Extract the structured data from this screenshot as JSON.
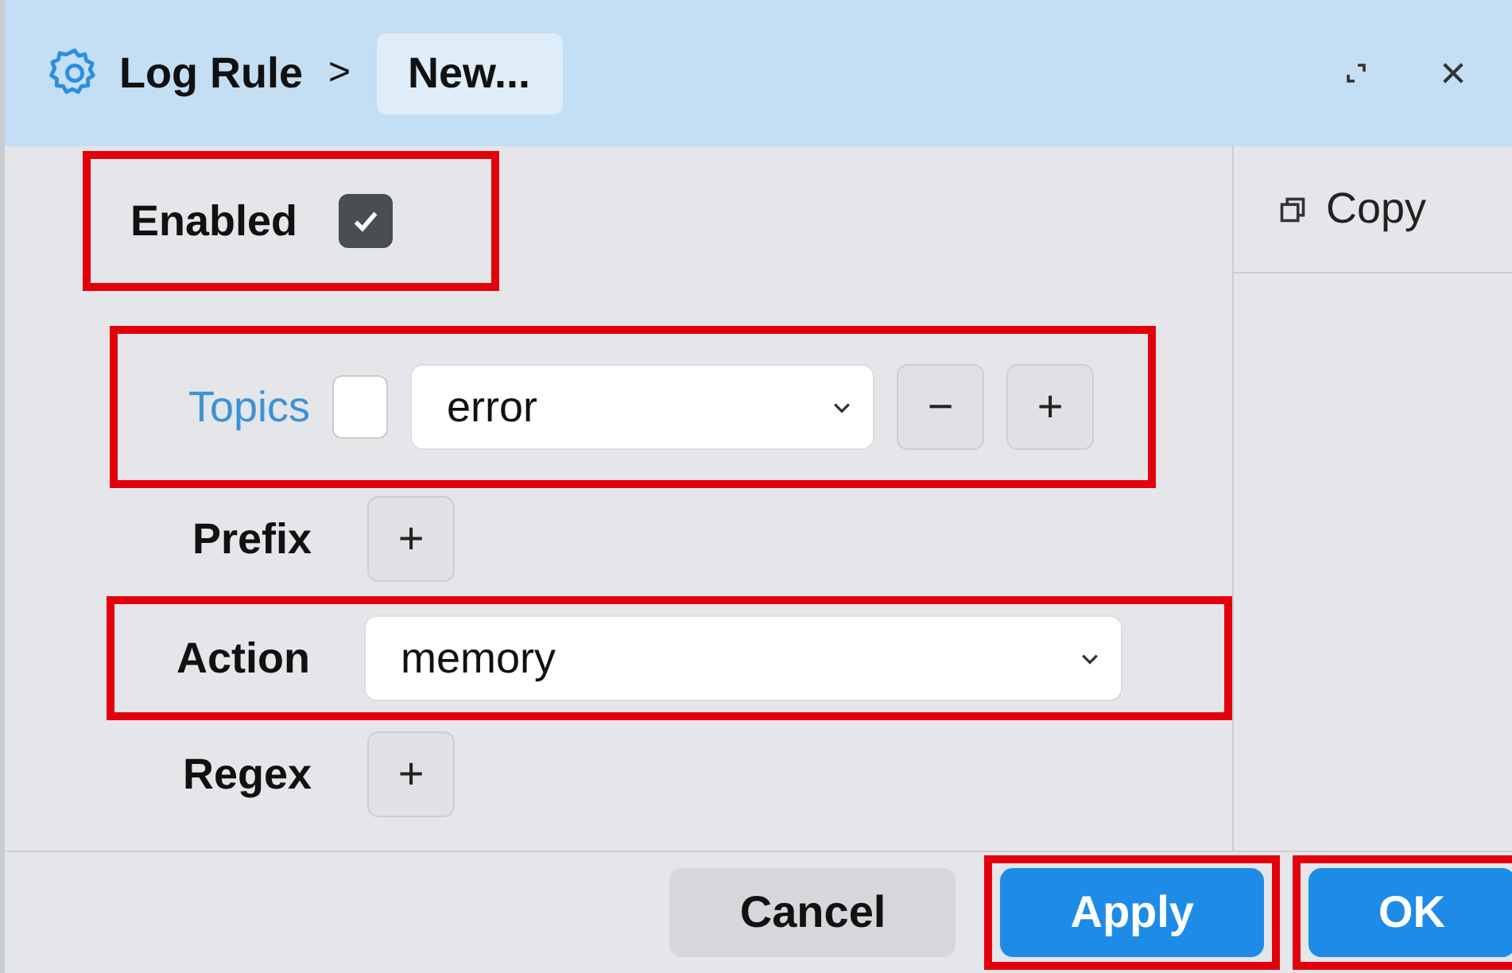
{
  "window": {
    "breadcrumb": "Log Rule",
    "separator": ">",
    "title": "New..."
  },
  "side_panel": {
    "copy_button": "Copy"
  },
  "enabled": {
    "label": "Enabled",
    "checked": true,
    "highlighted": true
  },
  "fields": [
    {
      "kind": "list",
      "label": "Topics",
      "link": true,
      "checked": false,
      "value": "error",
      "remove": "−",
      "add": "+",
      "highlighted": true
    },
    {
      "kind": "add",
      "label": "Prefix",
      "link": false,
      "add": "+",
      "highlighted": false
    },
    {
      "kind": "select",
      "label": "Action",
      "link": false,
      "value": "memory",
      "highlighted": true
    },
    {
      "kind": "add",
      "label": "Regex",
      "link": false,
      "add": "+",
      "highlighted": false
    }
  ],
  "buttons": [
    {
      "label": "Cancel",
      "primary": false,
      "highlighted": false
    },
    {
      "label": "Apply",
      "primary": true,
      "highlighted": true
    },
    {
      "label": "OK",
      "primary": true,
      "highlighted": true
    }
  ]
}
